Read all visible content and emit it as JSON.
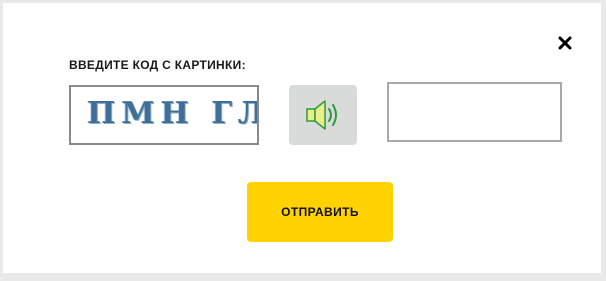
{
  "dialog": {
    "close_icon": "close-icon",
    "label": "ВВЕДИТЕ КОД С КАРТИНКИ:",
    "captcha_text": "ПМН ГЛ",
    "audio_icon": "speaker-icon",
    "answer_value": "",
    "answer_placeholder": "",
    "submit_label": "ОТПРАВИТЬ",
    "colors": {
      "submit_bg": "#ffd200",
      "audio_bg": "#d9dada",
      "speaker_fill": "#e9f08a",
      "speaker_stroke": "#2e9a3a",
      "captcha_ink": "#3f6f98"
    }
  }
}
